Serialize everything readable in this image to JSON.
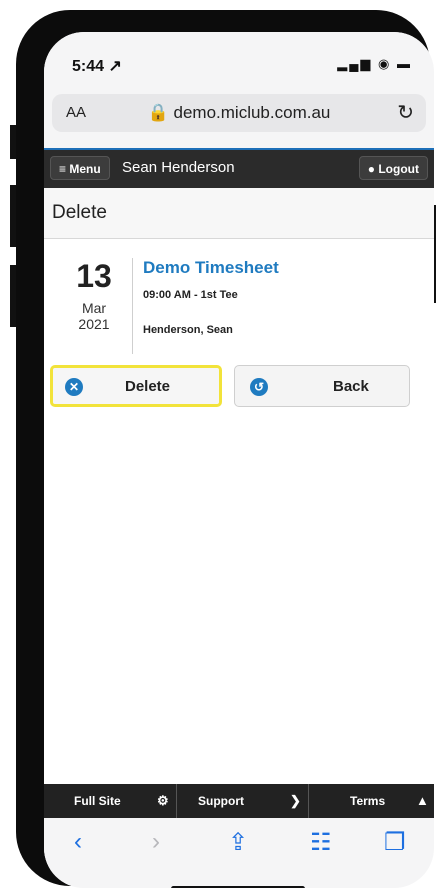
{
  "status_bar": {
    "time": "5:44 ↗",
    "icons": "▂▄▆ ◉ ▬"
  },
  "browser": {
    "text_size": "AA",
    "url": "🔒 demo.miclub.com.au",
    "reload_icon": "↻"
  },
  "navbar": {
    "menu_label": "≡ Menu",
    "user_name": "Sean Henderson",
    "logout_label": "● Logout"
  },
  "page": {
    "title": "Delete"
  },
  "booking": {
    "day": "13",
    "month": "Mar",
    "year": "2021",
    "title": "Demo Timesheet",
    "time": "09:00 AM - 1st Tee",
    "name": "Henderson, Sean"
  },
  "actions": {
    "delete_label": "Delete",
    "delete_icon": "✕",
    "back_label": "Back",
    "back_icon": "↺"
  },
  "site_footer": {
    "full_site": "Full Site",
    "full_site_icon": "⚙",
    "support": "Support",
    "support_icon": "❯",
    "terms": "Terms",
    "terms_icon": "▲"
  },
  "toolbar": {
    "back": "‹",
    "forward": "›",
    "share": "⇪",
    "bookmarks": "☷",
    "tabs": "❐"
  },
  "colors": {
    "accent": "#1f7bc0",
    "highlight": "#f2e33a",
    "nav_bg": "#2b2b2b"
  }
}
